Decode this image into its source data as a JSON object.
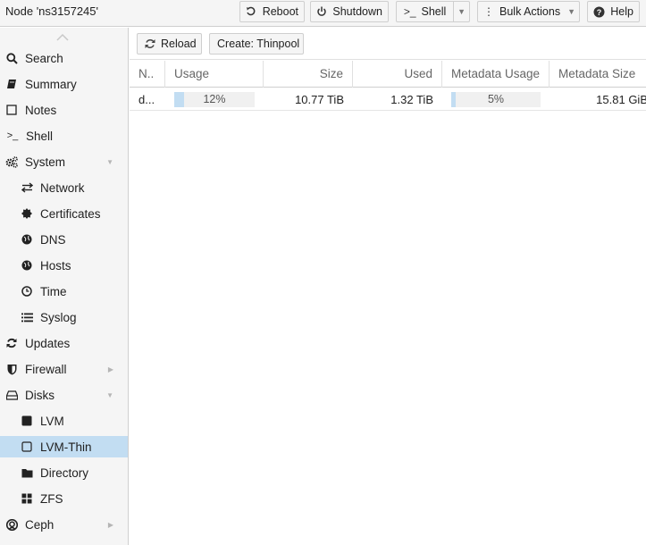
{
  "header": {
    "title": "Node 'ns3157245'",
    "buttons": {
      "reboot": "Reboot",
      "shutdown": "Shutdown",
      "shell": "Shell",
      "bulk_actions": "Bulk Actions",
      "help": "Help"
    }
  },
  "sidebar": {
    "items": [
      {
        "label": "Search",
        "icon": "search-icon"
      },
      {
        "label": "Summary",
        "icon": "book-icon"
      },
      {
        "label": "Notes",
        "icon": "note-icon"
      },
      {
        "label": "Shell",
        "icon": "terminal-icon"
      },
      {
        "label": "System",
        "icon": "gears-icon"
      },
      {
        "label": "Network",
        "icon": "exchange-icon"
      },
      {
        "label": "Certificates",
        "icon": "certificate-icon"
      },
      {
        "label": "DNS",
        "icon": "globe-icon"
      },
      {
        "label": "Hosts",
        "icon": "globe-icon"
      },
      {
        "label": "Time",
        "icon": "clock-icon"
      },
      {
        "label": "Syslog",
        "icon": "list-icon"
      },
      {
        "label": "Updates",
        "icon": "refresh-icon"
      },
      {
        "label": "Firewall",
        "icon": "shield-icon"
      },
      {
        "label": "Disks",
        "icon": "hdd-icon"
      },
      {
        "label": "LVM",
        "icon": "square-icon"
      },
      {
        "label": "LVM-Thin",
        "icon": "square-outline-icon",
        "selected": true
      },
      {
        "label": "Directory",
        "icon": "folder-icon"
      },
      {
        "label": "ZFS",
        "icon": "th-large-icon"
      },
      {
        "label": "Ceph",
        "icon": "ceph-icon"
      }
    ]
  },
  "toolbar": {
    "reload": "Reload",
    "create_thinpool": "Create: Thinpool"
  },
  "grid": {
    "columns": {
      "name": "N..",
      "usage": "Usage",
      "size": "Size",
      "used": "Used",
      "metadata_usage": "Metadata Usage",
      "metadata_size": "Metadata Size"
    },
    "rows": [
      {
        "name": "d...",
        "usage": "12%",
        "usage_fraction": 0.12,
        "size": "10.77 TiB",
        "used": "1.32 TiB",
        "metadata_usage": "5%",
        "metadata_usage_fraction": 0.05,
        "metadata_size": "15.81 GiB"
      }
    ]
  },
  "colors": {
    "selected_bg": "#c2ddf2",
    "bar_fill": "#c2ddf2",
    "panel_bg": "#f5f5f5"
  }
}
